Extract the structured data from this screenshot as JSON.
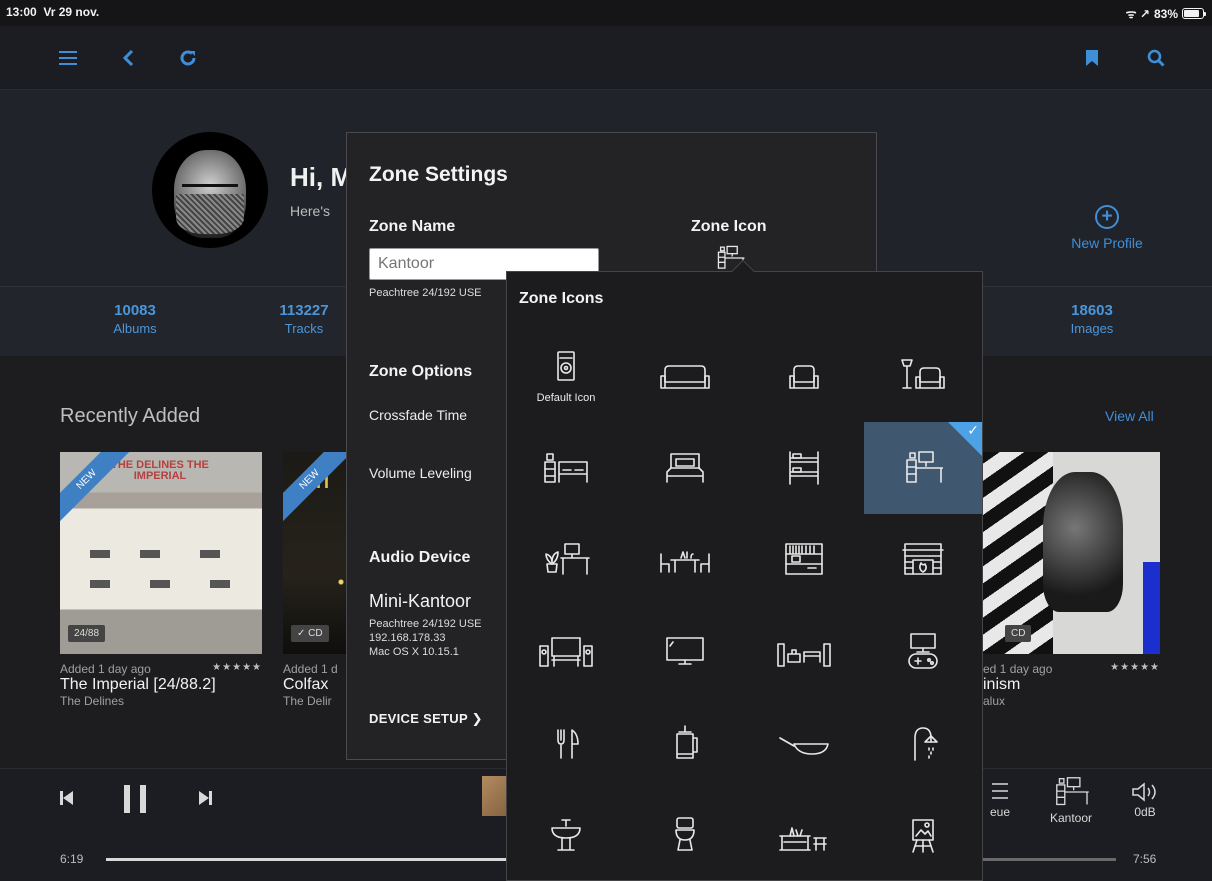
{
  "status_bar": {
    "time": "13:00",
    "date": "Vr 29 nov.",
    "signal": "ᯤ ↗",
    "battery": "83%",
    "battery_level": 0.83
  },
  "profile": {
    "greeting": "Hi, M",
    "subtitle": "Here's",
    "new_profile_label": "New Profile"
  },
  "stats": [
    {
      "num": "10083",
      "label": "Albums"
    },
    {
      "num": "113227",
      "label": "Tracks"
    },
    {
      "num": "18603",
      "label": "Images"
    }
  ],
  "recently_added": {
    "title": "Recently Added",
    "view_all": "View All",
    "albums": [
      {
        "added": "Added 1 day ago",
        "stars": "★★★★★",
        "title": "The Imperial [24/88.2]",
        "artist": "The Delines",
        "badge": "24/88",
        "ribbon": "NEW",
        "art_text": "THE DELINES THE IMPERIAL"
      },
      {
        "added": "Added 1 d",
        "title": "Colfax",
        "artist": "The Delir",
        "badge": "✓ CD",
        "ribbon": "NEW",
        "art_text": "TI"
      },
      {
        "added": "ed 1 day ago",
        "stars": "★★★★★",
        "title": "inism",
        "artist": "alux",
        "badge": "CD"
      }
    ]
  },
  "player": {
    "elapsed": "6:19",
    "total": "7:56",
    "progress": 0.8,
    "queue_label": "eue",
    "zone_label": "Kantoor",
    "volume_label": "0dB"
  },
  "zone_settings": {
    "title": "Zone Settings",
    "zone_name_label": "Zone Name",
    "zone_name_placeholder": "Kantoor",
    "zone_name_device": "Peachtree 24/192 USE",
    "zone_icon_label": "Zone Icon",
    "zone_options_label": "Zone Options",
    "crossfade_label": "Crossfade Time",
    "volume_leveling_label": "Volume Leveling",
    "audio_device_label": "Audio Device",
    "device_name": "Mini-Kantoor",
    "device_model": "Peachtree 24/192 USE",
    "device_ip": "192.168.178.33",
    "device_os": "Mac OS X 10.15.1",
    "device_setup": "DEVICE SETUP ❯"
  },
  "zone_icons": {
    "title": "Zone Icons",
    "default_label": "Default Icon",
    "selected": "desk-icon",
    "icons": [
      "speaker-icon",
      "sofa-icon",
      "armchair-icon",
      "lamp-armchair-icon",
      "bedside-bed-icon",
      "double-bed-icon",
      "bunk-bed-icon",
      "desk-icon",
      "plant-desk-icon",
      "dining-table-icon",
      "bookshelf-icon",
      "fireplace-icon",
      "home-theater-icon",
      "tv-icon",
      "living-room-icon",
      "gaming-icon",
      "cutlery-icon",
      "french-press-icon",
      "frying-pan-icon",
      "shower-icon",
      "sink-icon",
      "toilet-icon",
      "garden-bench-icon",
      "easel-icon"
    ]
  }
}
